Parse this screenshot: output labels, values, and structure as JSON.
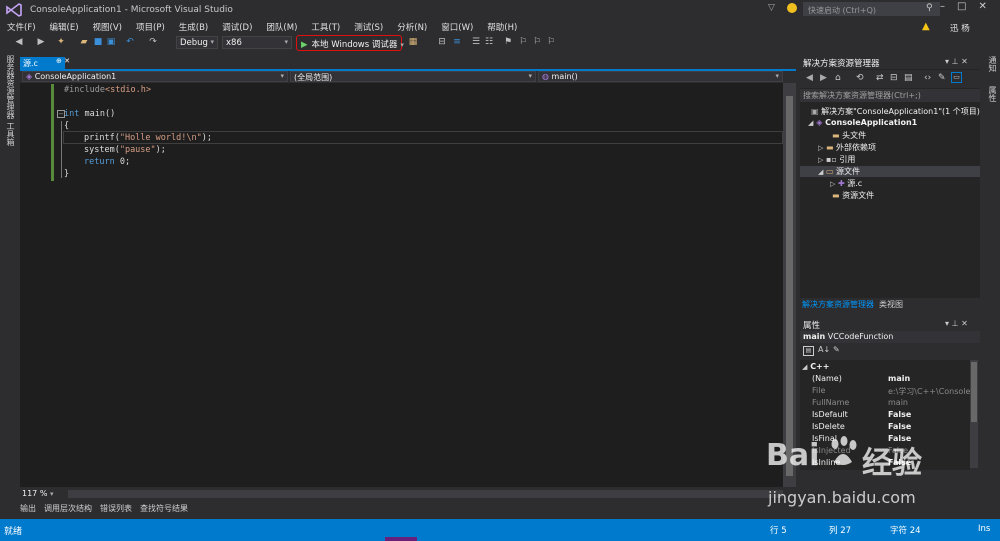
{
  "window": {
    "title": "ConsoleApplication1 - Microsoft Visual Studio",
    "quick_launch_placeholder": "快速启动 (Ctrl+Q)",
    "user": "迅 杨"
  },
  "menu": [
    "文件(F)",
    "编辑(E)",
    "视图(V)",
    "项目(P)",
    "生成(B)",
    "调试(D)",
    "团队(M)",
    "工具(T)",
    "测试(S)",
    "分析(N)",
    "窗口(W)",
    "帮助(H)"
  ],
  "toolbar": {
    "config": "Debug",
    "platform": "x86",
    "run_label": "本地 Windows 调试器"
  },
  "left_strip": [
    "服务器资源管理器",
    "工具箱"
  ],
  "editor": {
    "tab_label": "源.c",
    "nav_project": "ConsoleApplication1",
    "nav_scope": "(全局范围)",
    "nav_member": "main()",
    "zoom": "117 %",
    "code": {
      "line1": "#include",
      "line1_file": "<stdio.h>",
      "line3_kw": "int",
      "line3_rest": " main()",
      "line4": "{",
      "line5_fn": "printf(",
      "line5_str": "\"Holle world!\\n\"",
      "line5_end": ");",
      "line6_fn": "system(",
      "line6_str": "\"pause\"",
      "line6_end": ");",
      "line7_kw": "return",
      "line7_rest": " 0;",
      "line8": "}"
    }
  },
  "bottom_tabs": [
    "输出",
    "调用层次结构",
    "错误列表",
    "查找符号结果"
  ],
  "status": {
    "text": "就绪",
    "line": "行 5",
    "col": "列 27",
    "char": "字符 24",
    "mode": "Ins"
  },
  "solution_explorer": {
    "title": "解决方案资源管理器",
    "search_placeholder": "搜索解决方案资源管理器(Ctrl+;)",
    "solution": "解决方案\"ConsoleApplication1\"(1 个项目)",
    "project": "ConsoleApplication1",
    "items": [
      "头文件",
      "外部依赖项",
      "引用",
      "源文件",
      "源.c",
      "资源文件"
    ],
    "tab_active": "解决方案资源管理器",
    "tab_class": "类视图"
  },
  "properties": {
    "title": "属性",
    "object_name": "main",
    "object_type": "VCCodeFunction",
    "category": "C++",
    "rows": [
      {
        "name": "(Name)",
        "value": "main"
      },
      {
        "name": "File",
        "value": "e:\\学习\\C++\\Console"
      },
      {
        "name": "FullName",
        "value": "main"
      },
      {
        "name": "IsDefault",
        "value": "False"
      },
      {
        "name": "IsDelete",
        "value": "False"
      },
      {
        "name": "IsFinal",
        "value": "False"
      },
      {
        "name": "IsInjected",
        "value": "False"
      },
      {
        "name": "IsInline",
        "value": "False"
      }
    ]
  },
  "right_strip": [
    "通知",
    "属性"
  ],
  "watermark": {
    "brand": "Bai",
    "brand2": "经验",
    "url": "jingyan.baidu.com"
  }
}
